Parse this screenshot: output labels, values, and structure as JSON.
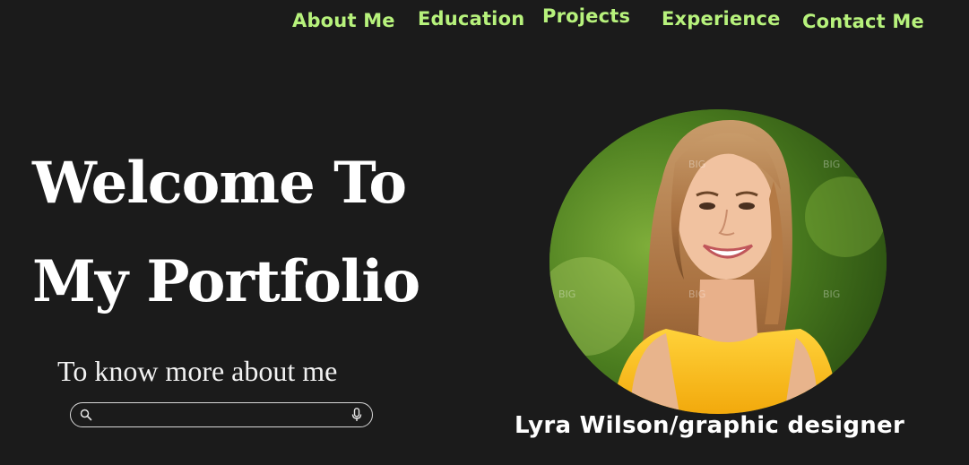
{
  "nav": {
    "items": [
      {
        "label": "About Me"
      },
      {
        "label": "Education"
      },
      {
        "label": "Projects"
      },
      {
        "label": "Experience"
      },
      {
        "label": "Contact Me"
      }
    ],
    "color": "#b7f27c"
  },
  "hero": {
    "title_line1": "Welcome To",
    "title_line2": "My Portfolio",
    "subtitle": "To know more about me"
  },
  "search": {
    "value": "",
    "placeholder": "",
    "search_icon": "search-icon",
    "mic_icon": "microphone-icon"
  },
  "profile": {
    "caption": "Lyra Wilson/graphic designer",
    "photo_watermark": "BIG"
  },
  "colors": {
    "background": "#1b1b1b",
    "accent": "#b7f27c",
    "text": "#ffffff"
  }
}
